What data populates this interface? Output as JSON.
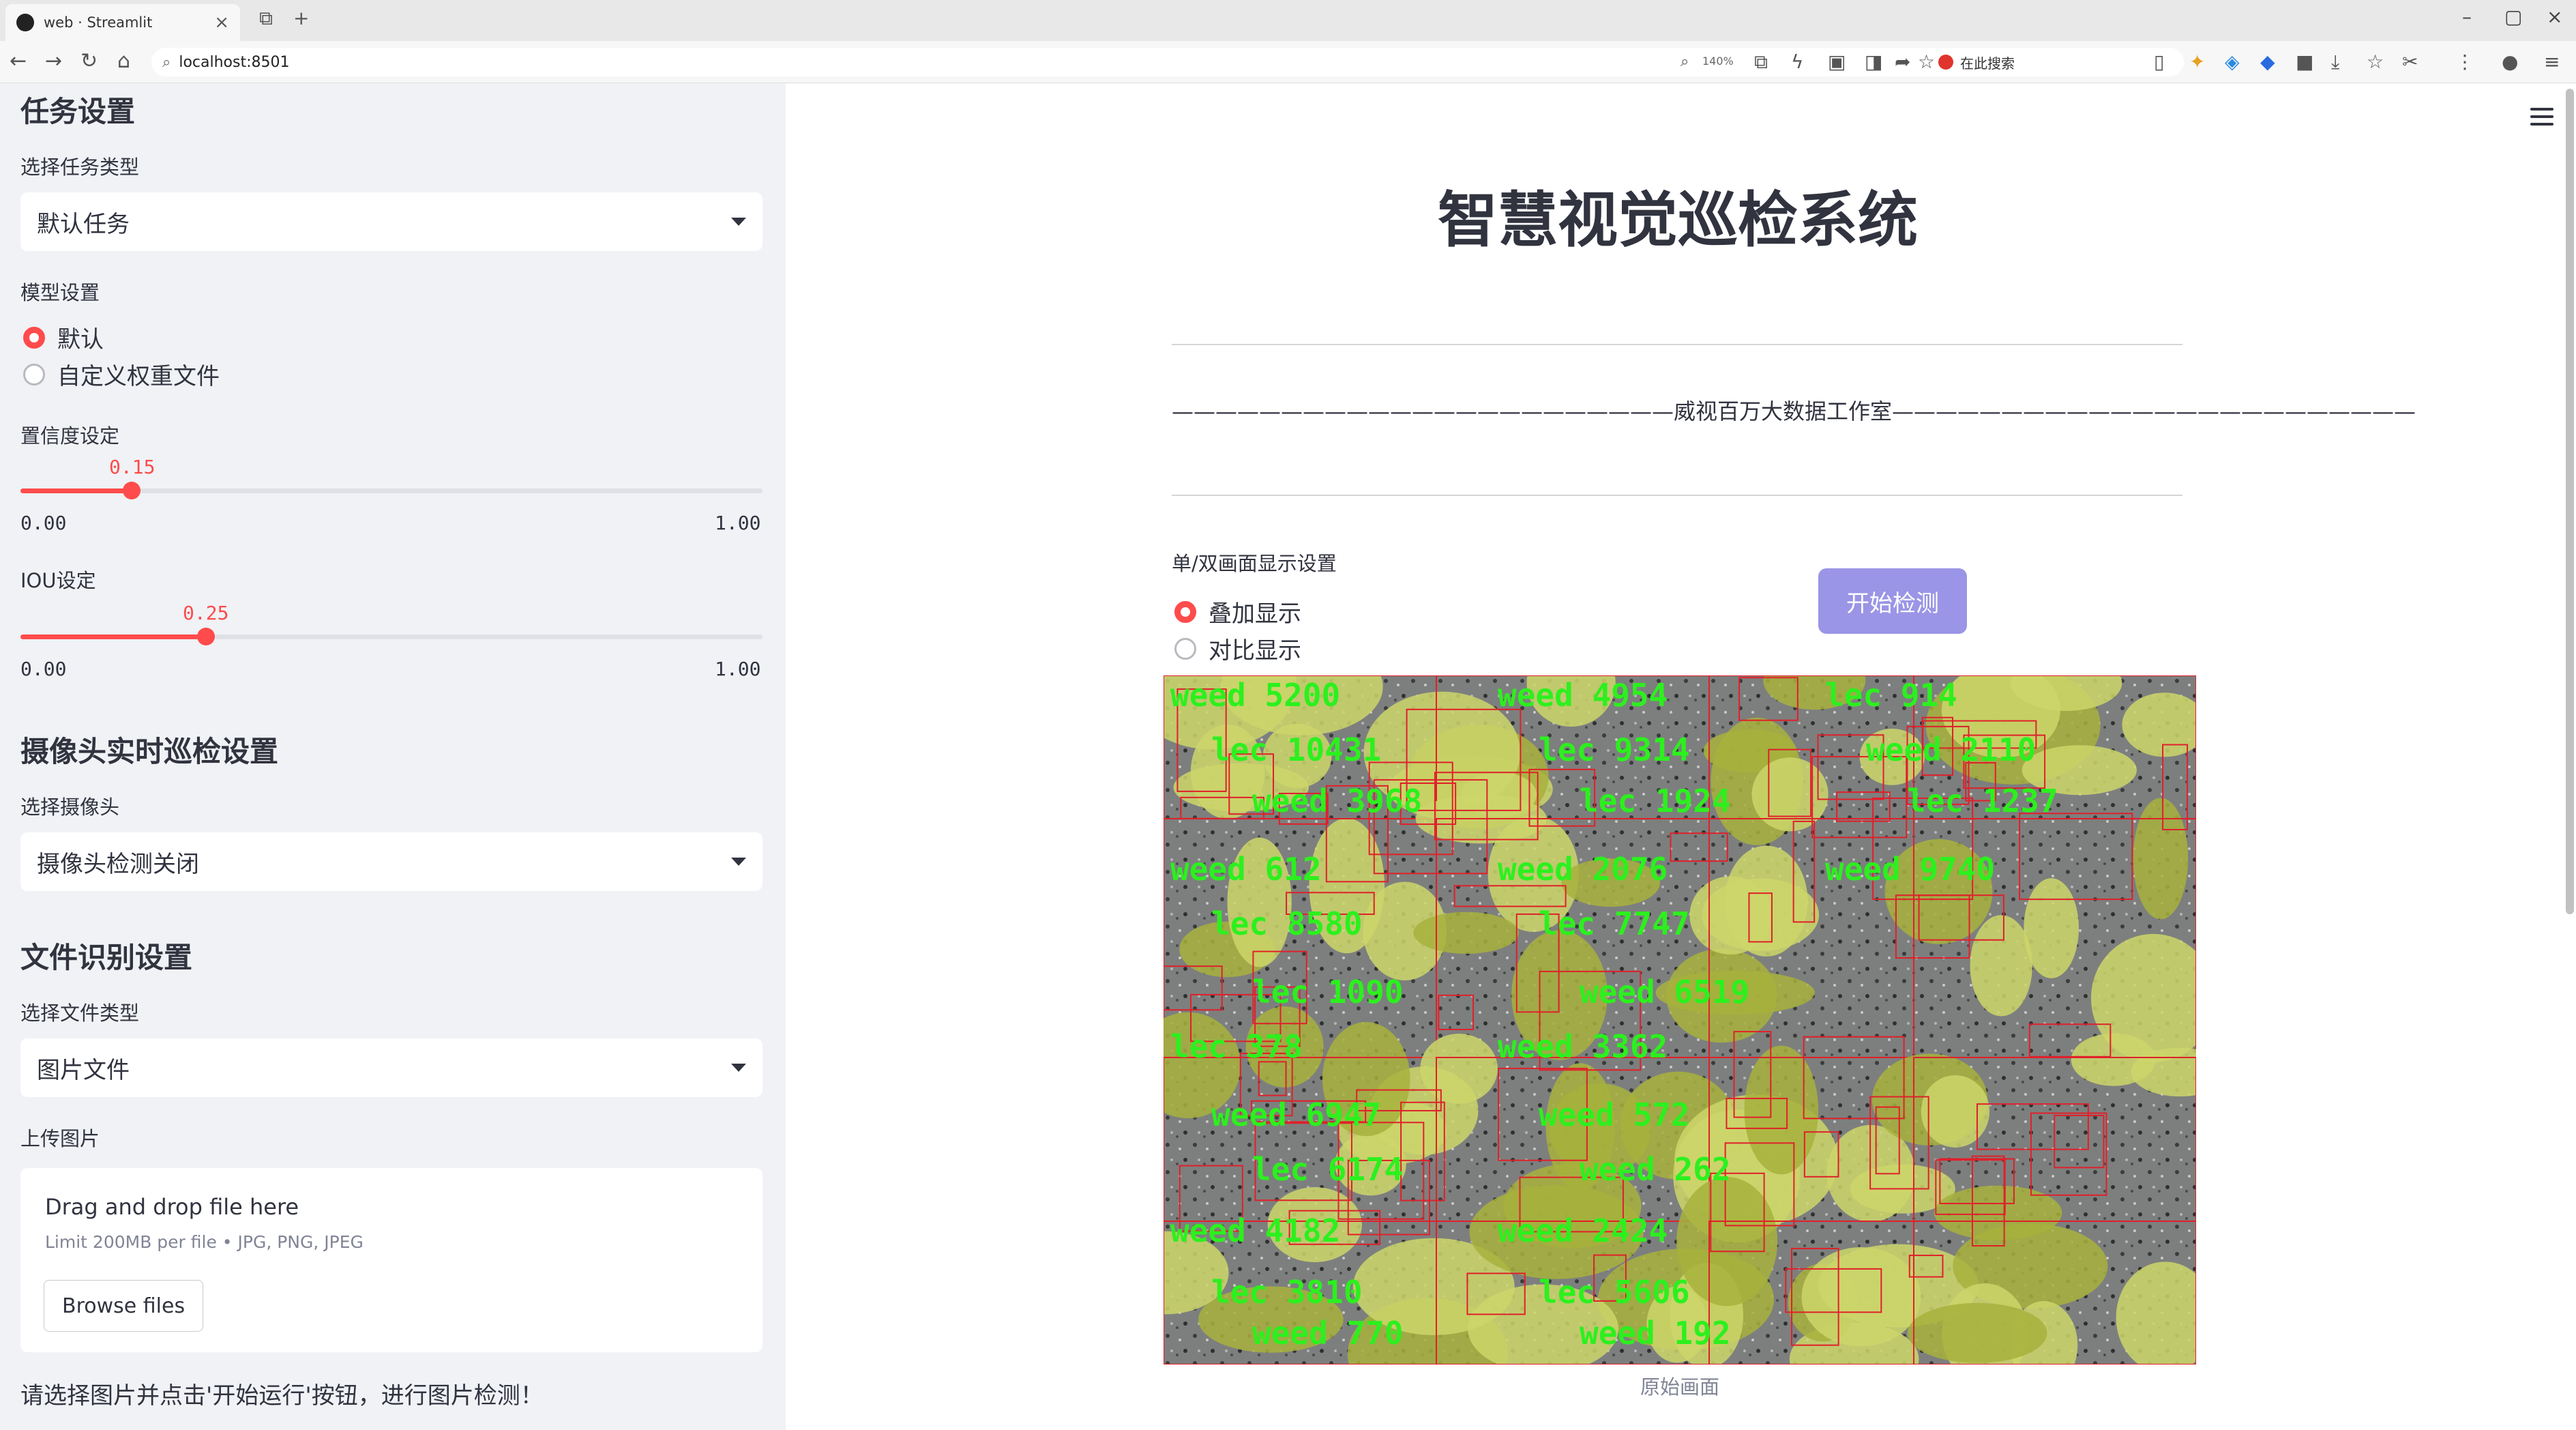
{
  "browser": {
    "tab_title": "web · Streamlit",
    "url": "localhost:8501",
    "zoom": "140%",
    "search_placeholder": "在此搜索"
  },
  "sidebar": {
    "task_section": {
      "title": "任务设置",
      "task_type_label": "选择任务类型",
      "task_type_value": "默认任务"
    },
    "model_section": {
      "label": "模型设置",
      "options": [
        "默认",
        "自定义权重文件"
      ],
      "selected_index": 0
    },
    "confidence": {
      "label": "置信度设定",
      "value": "0.15",
      "min": "0.00",
      "max": "1.00",
      "fraction": 0.15
    },
    "iou": {
      "label": "IOU设定",
      "value": "0.25",
      "min": "0.00",
      "max": "1.00",
      "fraction": 0.25
    },
    "camera_section": {
      "title": "摄像头实时巡检设置",
      "camera_label": "选择摄像头",
      "camera_value": "摄像头检测关闭"
    },
    "file_section": {
      "title": "文件识别设置",
      "file_type_label": "选择文件类型",
      "file_type_value": "图片文件",
      "upload_label": "上传图片",
      "drop_text": "Drag and drop file here",
      "limit_text": "Limit 200MB per file • JPG, PNG, JPEG",
      "browse_label": "Browse files"
    },
    "hint": "请选择图片并点击'开始运行'按钮，进行图片检测！"
  },
  "main": {
    "title": "智慧视觉巡检系统",
    "subtitle": "———————————————————————威视百万大数据工作室————————————————————————",
    "display_label": "单/双画面显示设置",
    "display_options": [
      "叠加显示",
      "对比显示"
    ],
    "display_selected_index": 0,
    "start_button": "开始检测",
    "image_caption": "原始画面",
    "detection_labels": [
      "weed 5200",
      "lec 10431",
      "weed 3968",
      "weed 612",
      "lec 8580",
      "lec 1090",
      "lec 378",
      "weed 6947",
      "lec 6174",
      "weed 4182",
      "lec 3810",
      "weed 770",
      "weed 4954",
      "lec 9314",
      "lec 1924",
      "weed 2076",
      "lec 7747",
      "weed 6519",
      "weed 3362",
      "weed 572",
      "weed 262",
      "weed 2424",
      "lec 5606",
      "weed 192",
      "lec 914",
      "weed 2110",
      "lec 1237",
      "weed 9740"
    ]
  },
  "colors": {
    "accent": "#ff4b4b",
    "start_button": "#9a95e6",
    "sidebar_bg": "#f0f2f6",
    "detection_box": "#e0202a",
    "detection_text": "#2cf01e"
  }
}
